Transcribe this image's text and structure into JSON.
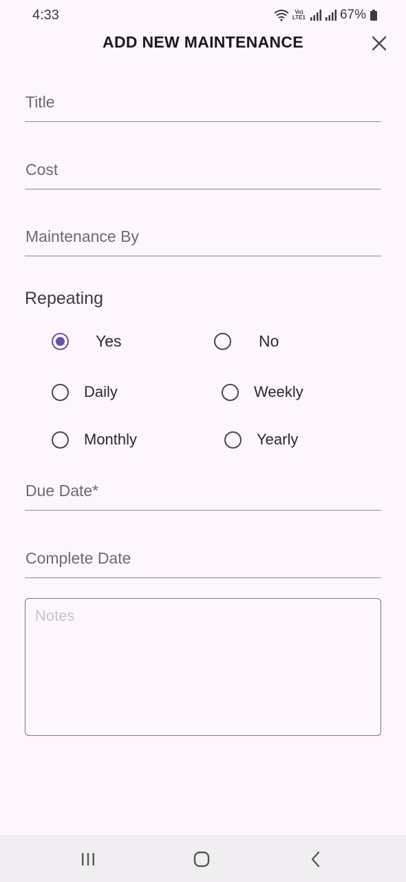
{
  "status_bar": {
    "time": "4:33",
    "battery": "67%",
    "lte_top": "Vo)",
    "lte_bottom": "LTE1",
    "icons": [
      "wifi-icon",
      "signal-icon",
      "signal-icon",
      "battery-icon"
    ]
  },
  "header": {
    "title": "ADD NEW MAINTENANCE",
    "close_icon": "close-icon"
  },
  "fields": {
    "title": {
      "label": "Title",
      "value": ""
    },
    "cost": {
      "label": "Cost",
      "value": ""
    },
    "maintenance_by": {
      "label": "Maintenance By",
      "value": ""
    },
    "due_date": {
      "label": "Due Date*",
      "value": ""
    },
    "complete_date": {
      "label": "Complete Date",
      "value": ""
    }
  },
  "repeating": {
    "label": "Repeating",
    "options": [
      {
        "label": "Yes",
        "selected": true
      },
      {
        "label": "No",
        "selected": false
      }
    ],
    "frequency": [
      {
        "label": "Daily",
        "selected": false
      },
      {
        "label": "Weekly",
        "selected": false
      },
      {
        "label": "Monthly",
        "selected": false
      },
      {
        "label": "Yearly",
        "selected": false
      }
    ]
  },
  "notes": {
    "placeholder": "Notes",
    "value": ""
  },
  "nav_bar": {
    "icons": [
      "recent-apps-icon",
      "home-icon",
      "back-icon"
    ]
  },
  "colors": {
    "accent": "#6a4fa6",
    "background": "#fdf7fd"
  }
}
